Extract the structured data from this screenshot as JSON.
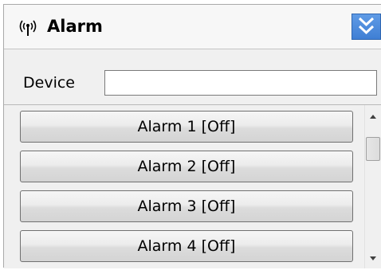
{
  "panel": {
    "title": "Alarm",
    "icon": "antenna-icon",
    "collapse_icon": "double-chevron-down-icon",
    "accent_color": "#4a8be0"
  },
  "device": {
    "label": "Device",
    "value": ""
  },
  "alarms": [
    {
      "label": "Alarm 1 [Off]"
    },
    {
      "label": "Alarm 2 [Off]"
    },
    {
      "label": "Alarm 3 [Off]"
    },
    {
      "label": "Alarm 4 [Off]"
    }
  ]
}
